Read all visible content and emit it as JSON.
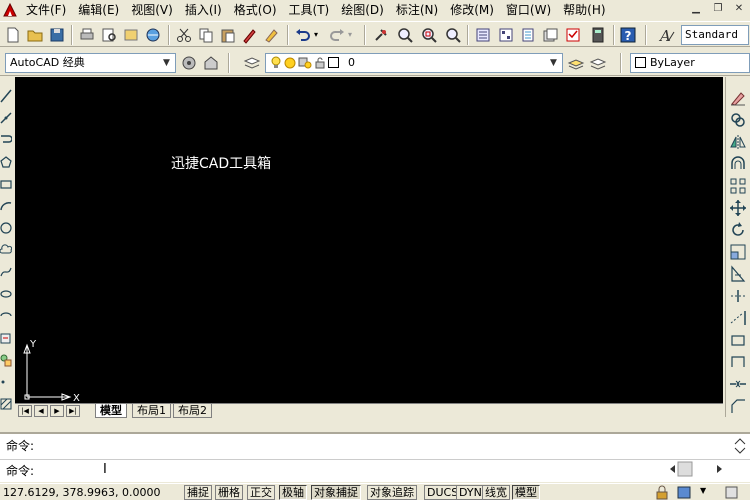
{
  "menubar": {
    "items": [
      "文件(F)",
      "编辑(E)",
      "视图(V)",
      "插入(I)",
      "格式(O)",
      "工具(T)",
      "绘图(D)",
      "标注(N)",
      "修改(M)",
      "窗口(W)",
      "帮助(H)"
    ]
  },
  "toolbar": {
    "text_style": "Standard"
  },
  "properties": {
    "workspace": "AutoCAD 经典",
    "layer": "0",
    "color": "ByLayer"
  },
  "canvas": {
    "text": "迅捷CAD工具箱",
    "ucs_x": "X",
    "ucs_y": "Y"
  },
  "layout_tabs": [
    "模型",
    "布局1",
    "布局2"
  ],
  "command": {
    "line1": "命令:",
    "line2": "命令:"
  },
  "status": {
    "coords": "127.6129, 378.9963, 0.0000",
    "toggles": [
      {
        "label": "捕捉",
        "on": false
      },
      {
        "label": "栅格",
        "on": false
      },
      {
        "label": "正交",
        "on": false
      },
      {
        "label": "极轴",
        "on": true
      },
      {
        "label": "对象捕捉",
        "on": true
      },
      {
        "label": "对象追踪",
        "on": false
      },
      {
        "label": "DUCS",
        "on": false
      },
      {
        "label": "DYN",
        "on": false
      },
      {
        "label": "线宽",
        "on": false
      },
      {
        "label": "模型",
        "on": true
      }
    ]
  }
}
